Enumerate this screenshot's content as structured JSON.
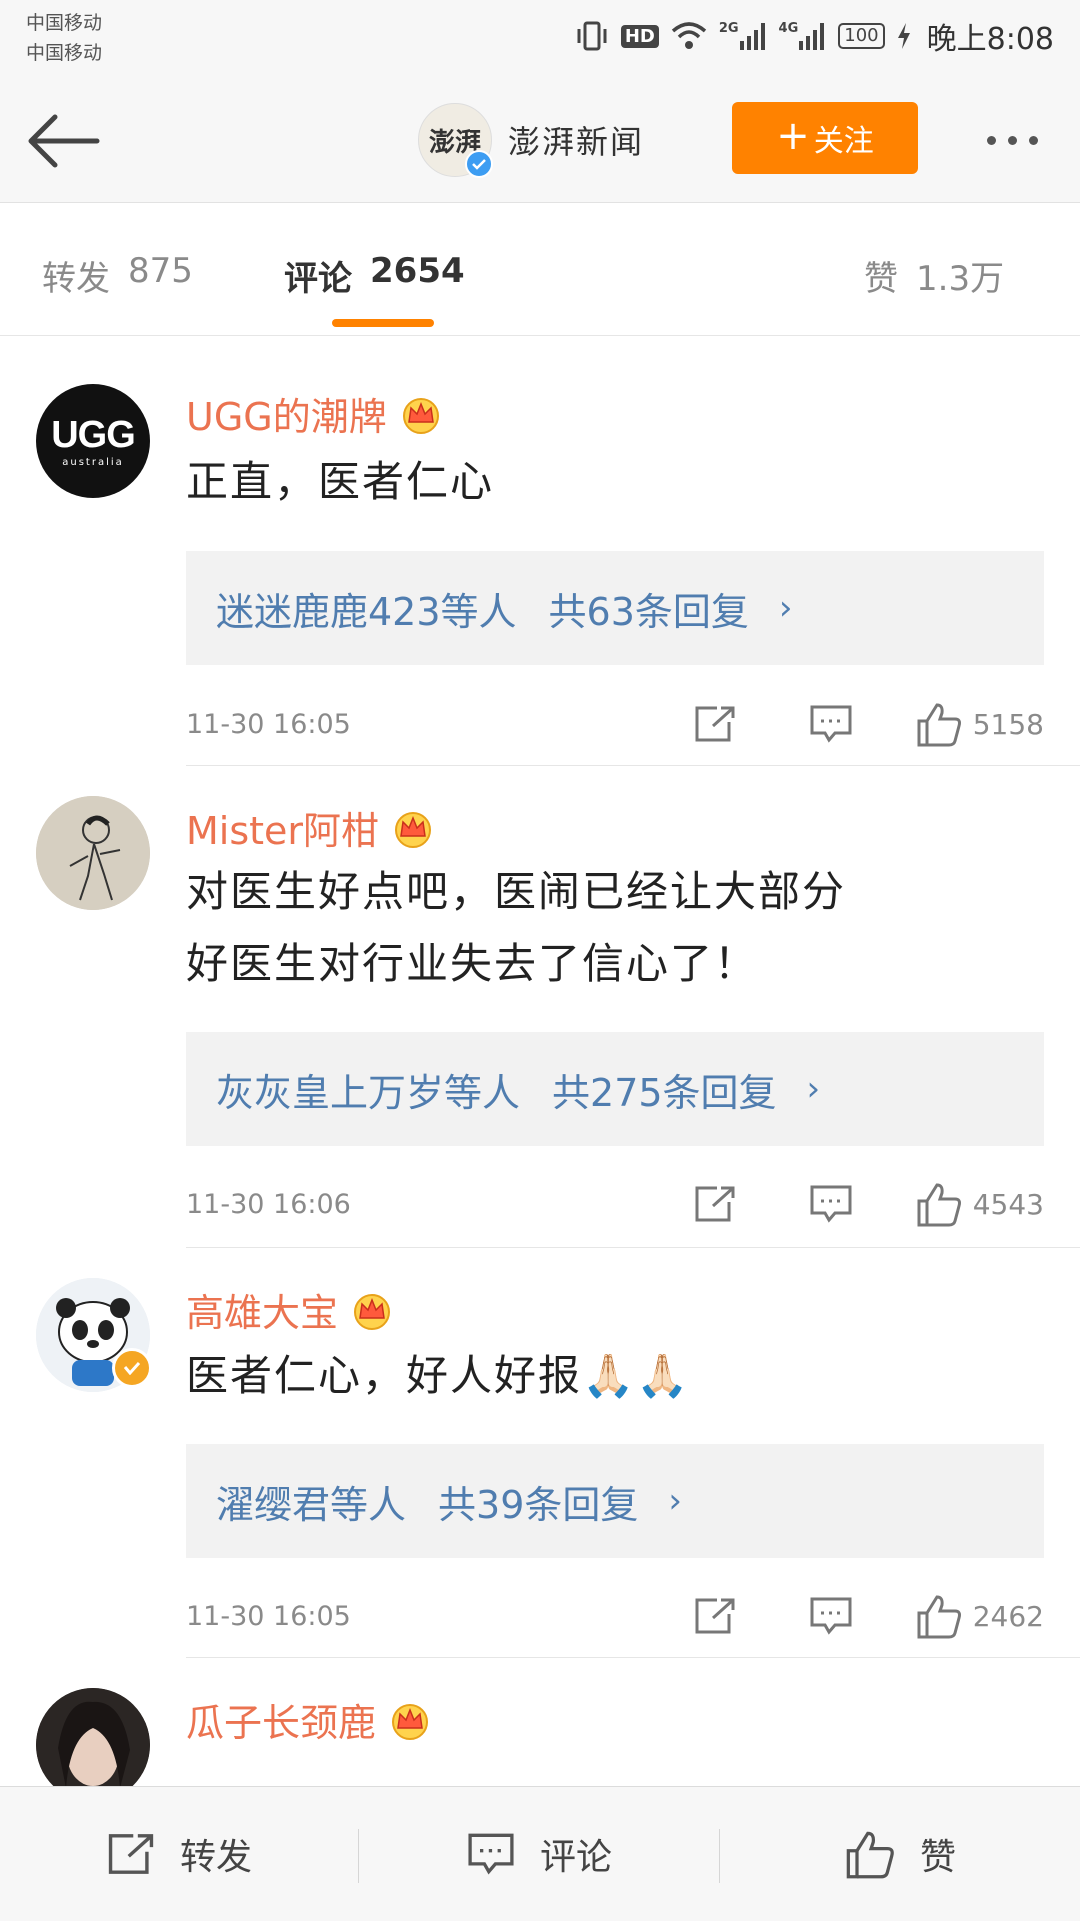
{
  "status_bar": {
    "carrier1": "中国移动",
    "carrier2": "中国移动",
    "hd": "HD",
    "net1": "2G",
    "net2": "4G",
    "battery": "100",
    "time": "晚上8:08"
  },
  "header": {
    "avatar_text": "澎湃",
    "account_name": "澎湃新闻",
    "follow_label": "关注"
  },
  "tabs": [
    {
      "label": "转发",
      "count": "875"
    },
    {
      "label": "评论",
      "count": "2654"
    },
    {
      "label": "赞",
      "count": "1.3万"
    }
  ],
  "comments": [
    {
      "username": "UGG的潮牌",
      "avatar_text": "UGG",
      "avatar_subtext": "australia",
      "text_lines": [
        "正直，医者仁心"
      ],
      "replies": {
        "who": "迷迷鹿鹿423等人",
        "count": "共63条回复"
      },
      "time": "11-30  16:05",
      "likes": "5158"
    },
    {
      "username": "Mister阿柑",
      "text_lines": [
        "对医生好点吧，医闹已经让大部分",
        "好医生对行业失去了信心了！"
      ],
      "replies": {
        "who": "灰灰皇上万岁等人",
        "count": "共275条回复"
      },
      "time": "11-30  16:06",
      "likes": "4543"
    },
    {
      "username": "高雄大宝",
      "text_lines": [
        "医者仁心，好人好报🙏🏻🙏🏻"
      ],
      "replies": {
        "who": "濯缨君等人",
        "count": "共39条回复"
      },
      "time": "11-30  16:05",
      "likes": "2462"
    },
    {
      "username": "瓜子长颈鹿"
    }
  ],
  "bottom_bar": {
    "repost": "转发",
    "comment": "评论",
    "like": "赞"
  },
  "colors": {
    "accent": "#ff8200",
    "username": "#eb7350",
    "link": "#507daf"
  }
}
